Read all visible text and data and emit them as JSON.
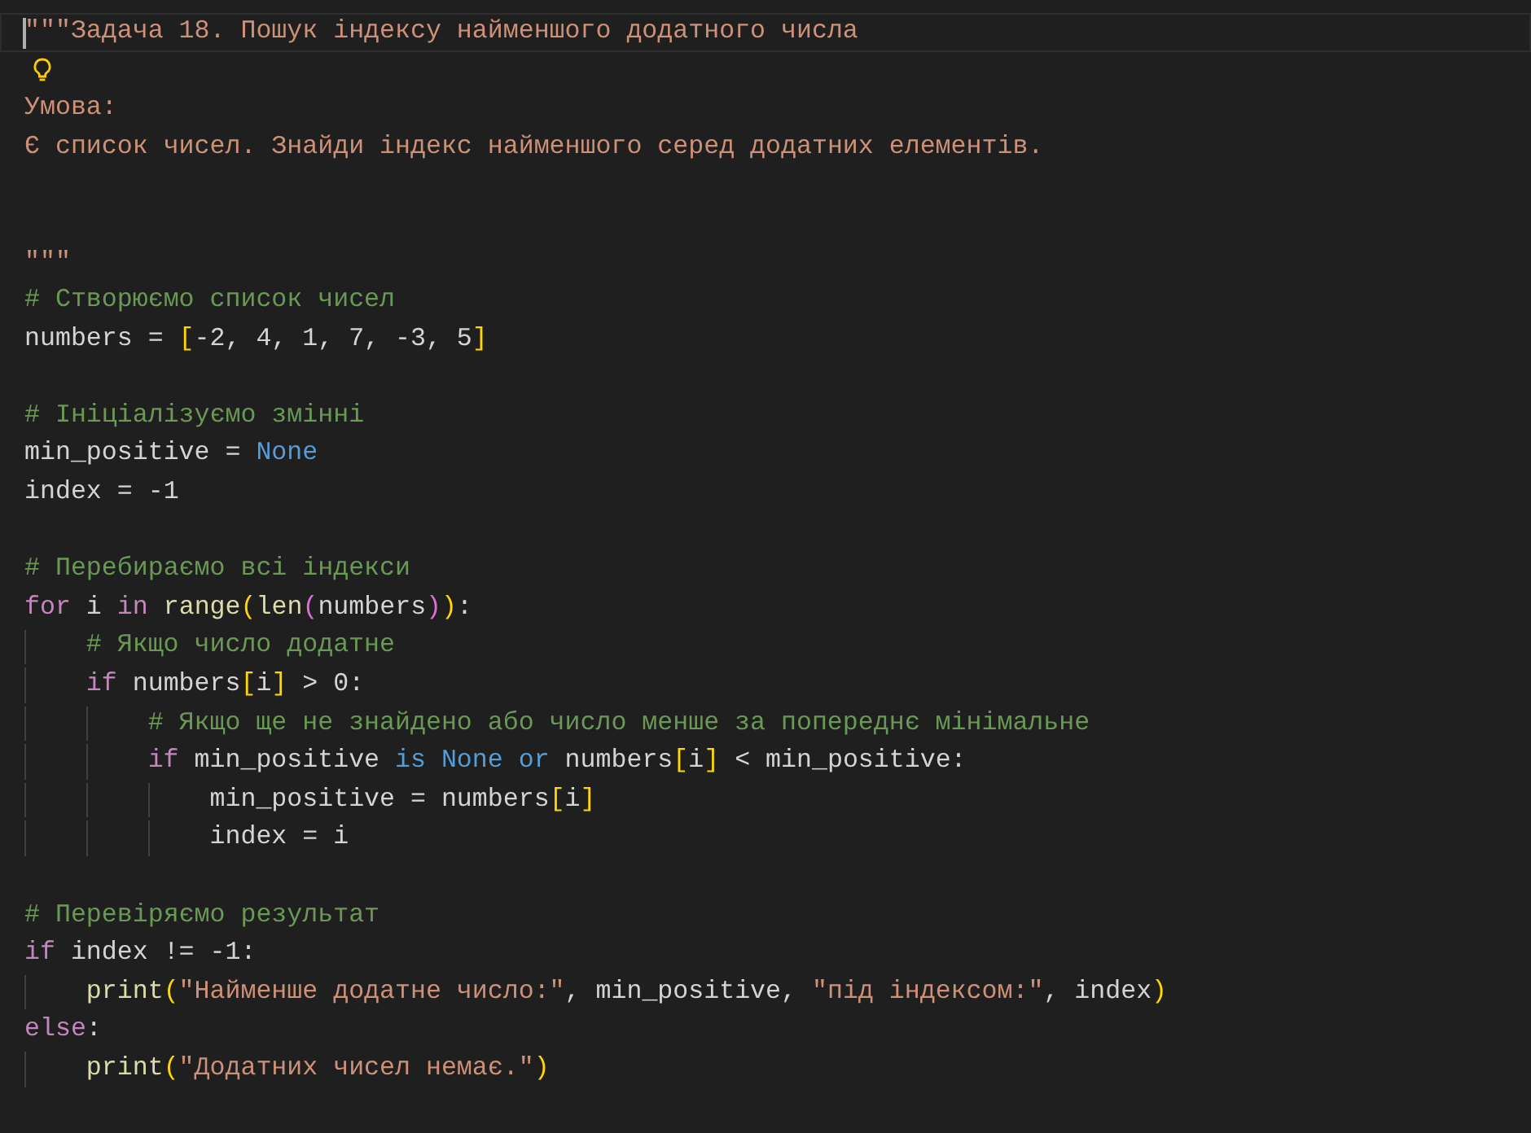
{
  "editor": {
    "lines": [
      {
        "kind": "code",
        "current": true,
        "cursor": true,
        "tokens": [
          {
            "kind": "string",
            "text": "\"\"\"Задача 18. Пошук індексу найменшого додатного числа"
          }
        ]
      },
      {
        "kind": "lightbulb"
      },
      {
        "kind": "code",
        "tokens": [
          {
            "kind": "string",
            "text": "Умова:"
          }
        ]
      },
      {
        "kind": "code",
        "tokens": [
          {
            "kind": "string",
            "text": "Є список чисел. Знайди індекс найменшого серед додатних елементів."
          }
        ]
      },
      {
        "kind": "blank"
      },
      {
        "kind": "blank"
      },
      {
        "kind": "code",
        "tokens": [
          {
            "kind": "string",
            "text": "\"\"\""
          }
        ]
      },
      {
        "kind": "code",
        "tokens": [
          {
            "kind": "comment",
            "text": "# Створюємо список чисел"
          }
        ]
      },
      {
        "kind": "code",
        "tokens": [
          {
            "kind": "plain",
            "text": "numbers = "
          },
          {
            "kind": "bracket1",
            "text": "["
          },
          {
            "kind": "number",
            "text": "-2, 4, 1, 7, -3, 5"
          },
          {
            "kind": "bracket1",
            "text": "]"
          }
        ]
      },
      {
        "kind": "blank"
      },
      {
        "kind": "code",
        "tokens": [
          {
            "kind": "comment",
            "text": "# Ініціалізуємо змінні"
          }
        ]
      },
      {
        "kind": "code",
        "tokens": [
          {
            "kind": "plain",
            "text": "min_positive = "
          },
          {
            "kind": "constant",
            "text": "None"
          }
        ]
      },
      {
        "kind": "code",
        "tokens": [
          {
            "kind": "plain",
            "text": "index = -1"
          }
        ]
      },
      {
        "kind": "blank"
      },
      {
        "kind": "code",
        "tokens": [
          {
            "kind": "comment",
            "text": "# Перебираємо всі індекси"
          }
        ]
      },
      {
        "kind": "code",
        "tokens": [
          {
            "kind": "keyword",
            "text": "for"
          },
          {
            "kind": "plain",
            "text": " i "
          },
          {
            "kind": "keyword",
            "text": "in"
          },
          {
            "kind": "function",
            "text": " range"
          },
          {
            "kind": "bracket1",
            "text": "("
          },
          {
            "kind": "function",
            "text": "len"
          },
          {
            "kind": "bracket2",
            "text": "("
          },
          {
            "kind": "plain",
            "text": "numbers"
          },
          {
            "kind": "bracket2",
            "text": ")"
          },
          {
            "kind": "bracket1",
            "text": ")"
          },
          {
            "kind": "plain",
            "text": ":"
          }
        ]
      },
      {
        "kind": "code",
        "tokens": [
          {
            "kind": "comment",
            "text": "    # Якщо число додатне"
          }
        ]
      },
      {
        "kind": "code",
        "tokens": [
          {
            "kind": "keyword",
            "text": "    if"
          },
          {
            "kind": "plain",
            "text": " numbers"
          },
          {
            "kind": "bracket1",
            "text": "["
          },
          {
            "kind": "plain",
            "text": "i"
          },
          {
            "kind": "bracket1",
            "text": "]"
          },
          {
            "kind": "plain",
            "text": " > 0:"
          }
        ]
      },
      {
        "kind": "code",
        "tokens": [
          {
            "kind": "comment",
            "text": "        # Якщо ще не знайдено або число менше за попереднє мінімальне"
          }
        ]
      },
      {
        "kind": "code",
        "tokens": [
          {
            "kind": "keyword",
            "text": "        if"
          },
          {
            "kind": "plain",
            "text": " min_positive "
          },
          {
            "kind": "constant",
            "text": "is None or"
          },
          {
            "kind": "plain",
            "text": " numbers"
          },
          {
            "kind": "bracket1",
            "text": "["
          },
          {
            "kind": "plain",
            "text": "i"
          },
          {
            "kind": "bracket1",
            "text": "]"
          },
          {
            "kind": "plain",
            "text": " < min_positive:"
          }
        ]
      },
      {
        "kind": "code",
        "tokens": [
          {
            "kind": "plain",
            "text": "            min_positive = numbers"
          },
          {
            "kind": "bracket1",
            "text": "["
          },
          {
            "kind": "plain",
            "text": "i"
          },
          {
            "kind": "bracket1",
            "text": "]"
          }
        ]
      },
      {
        "kind": "code",
        "tokens": [
          {
            "kind": "plain",
            "text": "            index = i"
          }
        ]
      },
      {
        "kind": "blank"
      },
      {
        "kind": "code",
        "tokens": [
          {
            "kind": "comment",
            "text": "# Перевіряємо результат"
          }
        ]
      },
      {
        "kind": "code",
        "tokens": [
          {
            "kind": "keyword",
            "text": "if"
          },
          {
            "kind": "plain",
            "text": " index != -1:"
          }
        ]
      },
      {
        "kind": "code",
        "tokens": [
          {
            "kind": "function",
            "text": "    print"
          },
          {
            "kind": "bracket1",
            "text": "("
          },
          {
            "kind": "string",
            "text": "\"Найменше додатне число:\""
          },
          {
            "kind": "plain",
            "text": ", min_positive, "
          },
          {
            "kind": "string",
            "text": "\"під індексом:\""
          },
          {
            "kind": "plain",
            "text": ", index"
          },
          {
            "kind": "bracket1",
            "text": ")"
          }
        ]
      },
      {
        "kind": "code",
        "tokens": [
          {
            "kind": "keyword",
            "text": "else"
          },
          {
            "kind": "plain",
            "text": ":"
          }
        ]
      },
      {
        "kind": "code",
        "tokens": [
          {
            "kind": "function",
            "text": "    print"
          },
          {
            "kind": "bracket1",
            "text": "("
          },
          {
            "kind": "string",
            "text": "\"Додатних чисел немає.\""
          },
          {
            "kind": "bracket1",
            "text": ")"
          }
        ]
      }
    ]
  }
}
